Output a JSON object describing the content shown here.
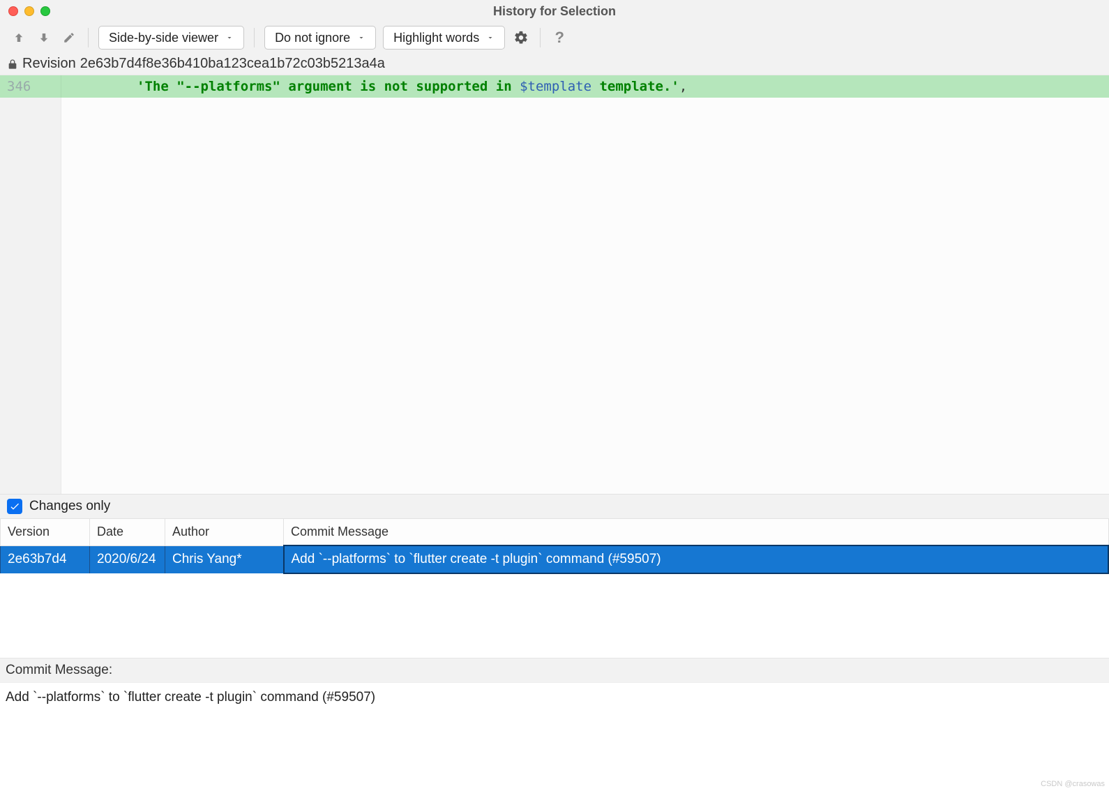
{
  "window": {
    "title": "History for Selection"
  },
  "toolbar": {
    "viewer": "Side-by-side viewer",
    "ignore": "Do not ignore",
    "highlight": "Highlight words"
  },
  "revision": {
    "label": "Revision",
    "hash": "2e63b7d4f8e36b410ba123cea1b72c03b5213a4a"
  },
  "diff": {
    "line_number": "346",
    "seg1": "'The \"--platforms\" argument is not supported in ",
    "seg2": "$template",
    "seg3": " template.'",
    "trail": ","
  },
  "filter": {
    "changes_only": "Changes only"
  },
  "table": {
    "headers": {
      "version": "Version",
      "date": "Date",
      "author": "Author",
      "message": "Commit Message"
    },
    "rows": [
      {
        "version": "2e63b7d4",
        "date": "2020/6/24",
        "author": "Chris Yang*",
        "message": "Add `--platforms` to `flutter create -t plugin` command (#59507)"
      }
    ]
  },
  "commit": {
    "label": "Commit Message:",
    "body": "Add `--platforms` to `flutter create -t plugin` command (#59507)"
  },
  "watermark": "CSDN @crasowas"
}
